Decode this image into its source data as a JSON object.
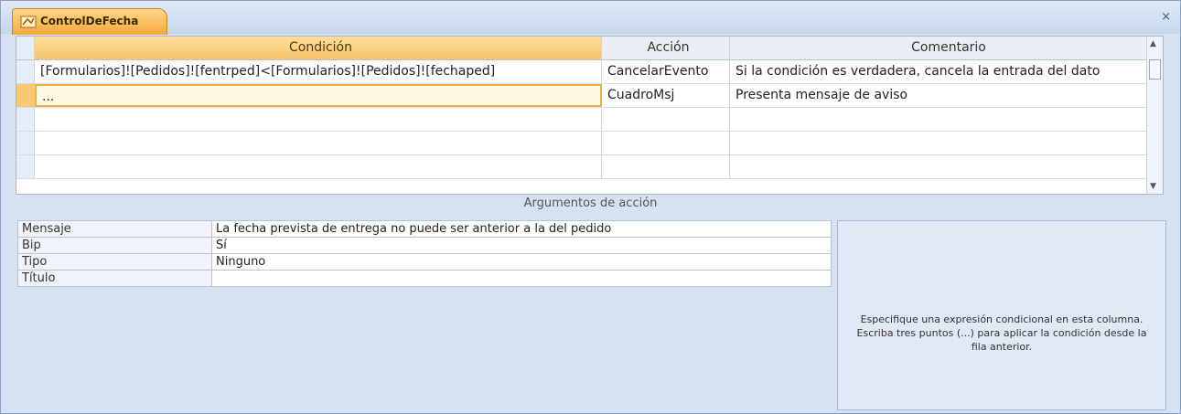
{
  "window": {
    "tab_title": "ControlDeFecha",
    "close_glyph": "×"
  },
  "grid": {
    "columns": [
      "Condición",
      "Acción",
      "Comentario"
    ],
    "rows": [
      {
        "condicion": "[Formularios]![Pedidos]![fentrped]<[Formularios]![Pedidos]![fechaped]",
        "accion": "CancelarEvento",
        "comentario": "Si la condición es verdadera, cancela la entrada del dato"
      },
      {
        "condicion": "...",
        "accion": "CuadroMsj",
        "comentario": "Presenta mensaje de aviso"
      },
      {
        "condicion": "",
        "accion": "",
        "comentario": ""
      },
      {
        "condicion": "",
        "accion": "",
        "comentario": ""
      },
      {
        "condicion": "",
        "accion": "",
        "comentario": ""
      }
    ]
  },
  "arguments": {
    "title": "Argumentos de acción",
    "rows": [
      {
        "label": "Mensaje",
        "value": "La fecha prevista de entrega no puede ser anterior a la del pedido"
      },
      {
        "label": "Bip",
        "value": "Sí"
      },
      {
        "label": "Tipo",
        "value": "Ninguno"
      },
      {
        "label": "Título",
        "value": ""
      }
    ]
  },
  "help": {
    "text": "Especifique una expresión condicional en esta columna. Escriba tres puntos (...) para aplicar la condición desde la fila anterior."
  },
  "colors": {
    "tab_accent": "#f3a83a",
    "header_selected": "#f7c36b",
    "frame": "#d6e2f1"
  }
}
